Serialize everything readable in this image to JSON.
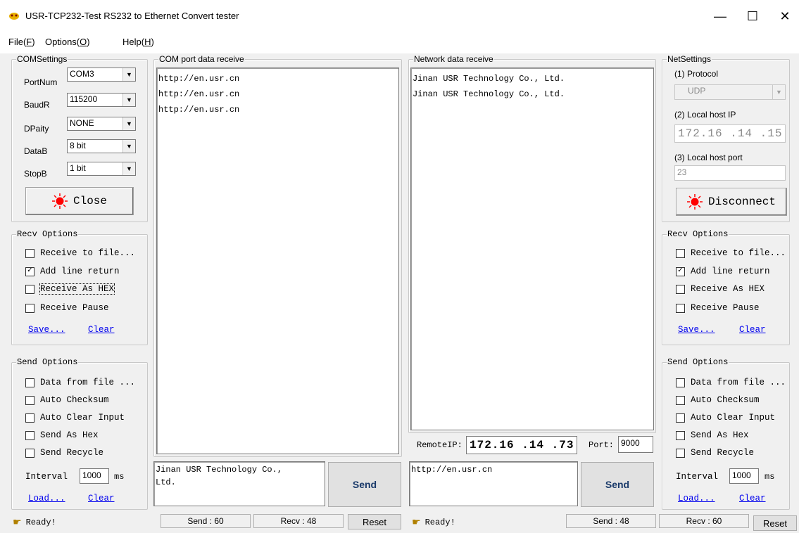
{
  "window": {
    "title": "USR-TCP232-Test  RS232 to Ethernet Convert tester",
    "min_glyph": "—",
    "max_glyph": "☐",
    "close_glyph": "✕"
  },
  "menu": {
    "file": "File(F)",
    "file_pre": "File(",
    "file_key": "F",
    "options_pre": "Options(",
    "options_key": "O",
    "help_pre": "Help(",
    "help_key": "H",
    "close_paren": ")"
  },
  "com_settings": {
    "title": "COMSettings",
    "portnum_label": "PortNum",
    "portnum_value": "COM3",
    "baud_label": "BaudR",
    "baud_value": "115200",
    "parity_label": "DPaity",
    "parity_value": "NONE",
    "datab_label": "DataB",
    "datab_value": "8 bit",
    "stopb_label": "StopB",
    "stopb_value": "1 bit",
    "button_label": "Close"
  },
  "com_recv": {
    "title": "Recv Options",
    "opt1": "Receive to file...",
    "opt2": "Add line return",
    "opt3": "Receive As HEX",
    "opt4": "Receive Pause",
    "save": "Save...",
    "clear": "Clear"
  },
  "com_send": {
    "title": "Send Options",
    "opt1": "Data from file ...",
    "opt2": "Auto Checksum",
    "opt3": "Auto Clear Input",
    "opt4": "Send As Hex",
    "opt5": "Send Recycle",
    "interval_label": "Interval",
    "interval_value": "1000",
    "interval_unit": "ms",
    "load": "Load...",
    "clear": "Clear"
  },
  "com_receive_panel": {
    "title": "COM port data receive",
    "lines": [
      "http://en.usr.cn",
      "http://en.usr.cn",
      "http://en.usr.cn"
    ]
  },
  "net_receive_panel": {
    "title": "Network data receive",
    "lines": [
      "Jinan USR Technology Co., Ltd.",
      "Jinan USR Technology Co., Ltd."
    ]
  },
  "remote": {
    "ip_label": "RemoteIP:",
    "ip_value": "172.16 .14 .73",
    "port_label": "Port:",
    "port_value": "9000"
  },
  "com_send_box": {
    "line1": "Jinan USR Technology Co.,",
    "line2": "Ltd.",
    "button": "Send"
  },
  "net_send_box": {
    "line1": "http://en.usr.cn",
    "button": "Send"
  },
  "net_settings": {
    "title": "NetSettings",
    "protocol_label": "(1) Protocol",
    "protocol_value": "UDP",
    "localip_label": "(2) Local host IP",
    "localip_value": "172.16 .14 .15",
    "localport_label": "(3) Local host port",
    "localport_value": "23",
    "button_label": "Disconnect"
  },
  "net_recv": {
    "title": "Recv Options",
    "opt1": "Receive to file...",
    "opt2": "Add line return",
    "opt3": "Receive As HEX",
    "opt4": "Receive Pause",
    "save": "Save...",
    "clear": "Clear"
  },
  "net_send": {
    "title": "Send Options",
    "opt1": "Data from file ...",
    "opt2": "Auto Checksum",
    "opt3": "Auto Clear Input",
    "opt4": "Send As Hex",
    "opt5": "Send Recycle",
    "interval_label": "Interval",
    "interval_value": "1000",
    "interval_unit": "ms",
    "load": "Load...",
    "clear": "Clear"
  },
  "status_left": {
    "ready": "Ready!",
    "send": "Send : 60",
    "recv": "Recv : 48",
    "reset": "Reset"
  },
  "status_right": {
    "ready": "Ready!",
    "send": "Send : 48",
    "recv": "Recv : 60",
    "reset": "Reset"
  },
  "checks": {
    "checked_glyph": "✓"
  },
  "colors": {
    "led_red": "#ff0000",
    "link_blue": "#0000ee",
    "panel_bg": "#f0f0f0"
  }
}
